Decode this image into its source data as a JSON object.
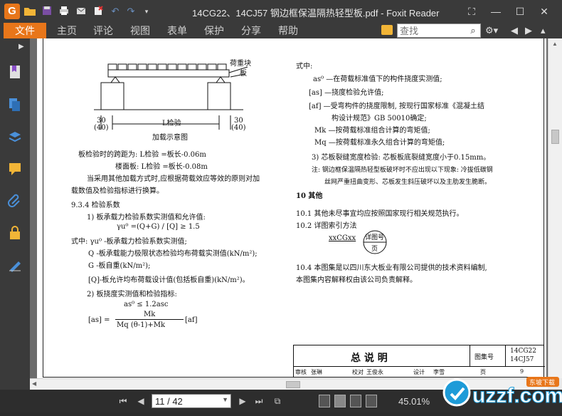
{
  "window": {
    "title": "14CG22、14CJ57 钢边框保温隔热轻型板.pdf - Foxit Reader",
    "app_logo": "G"
  },
  "quick_access": [
    "open-folder-icon",
    "save-icon",
    "print-icon",
    "email-icon",
    "delete-icon",
    "undo-icon",
    "redo-icon",
    "customize-icon"
  ],
  "menu": {
    "file": "文件",
    "items": [
      "主页",
      "评论",
      "视图",
      "表单",
      "保护",
      "分享",
      "帮助"
    ],
    "search_placeholder": "查找"
  },
  "sidebar_icons": [
    "bookmark-icon",
    "pages-icon",
    "layers-icon",
    "comments-icon",
    "attachments-icon",
    "security-icon",
    "signature-icon"
  ],
  "document": {
    "left": {
      "diagram_label_top": "荷重块",
      "diagram_label_plate": "板",
      "dim_left": "30",
      "dim_left_paren": "(40)",
      "dim_right": "30",
      "dim_right_paren": "(40)",
      "span_label": "L检验",
      "caption": "加载示意图",
      "span1": "板检验时的跨距为: L检验 =板长-0.06m",
      "span2": "楼面板: L检验 =板长-0.08m",
      "para1": "当采用其他加载方式时,应根据荷载效应等效的原则对加",
      "para2": "载数值及检验指标进行换算。",
      "sec934": "9.3.4 检验系数",
      "item1": "1) 板承载力检验系数实测值和允许值:",
      "formula1": "γu⁰ =(Q+G) / [Q] ≥ 1.5",
      "where1": "式中: γu⁰ -板承载力检验系数实测值;",
      "where2": "Q -板承载能力极限状态检验均布荷载实测值(kN/m²);",
      "where3": "G -板自重(kN/m²);",
      "where4": "[Q]-板允许均布荷载设计值(包括板自重)(kN/m²)。",
      "item2": "2) 板挠度实测值和检验指标:",
      "formula2": "as⁰ ≤ 1.2asc",
      "formula3_left": "[as] =",
      "formula3_num": "Mk",
      "formula3_den": "Mq (θ-1)+Mk",
      "formula3_right": "[af]"
    },
    "right": {
      "where_head": "式中:",
      "r1": "as⁰ —在荷载标准值下的构件挠度实测值;",
      "r2": "[as] —挠度检验允许值;",
      "r3": "[af] —受弯构件的挠度限制, 按现行国家标准《混凝土结",
      "r4": "构设计规范》GB 50010确定;",
      "r5": "Mk —按荷载标准组合计算的弯矩值;",
      "r6": "Mq —按荷载标准永久组合计算的弯矩值;",
      "r7": "3) 芯板裂缝宽度检验: 芯板板底裂缝宽度小于0.15mm。",
      "note1": "注: 钢边框保温隔热轻型板破坏时不应出现以下现象: 冷拔低碳钢",
      "note2": "丝网严重扭曲变形、芯板发生斜压破坏以及主肋发生脆断。",
      "sec10": "10  其他",
      "s101": "10.1 其他未尽事宜均应按照国家现行相关规范执行。",
      "s102": "10.2 详图索引方法",
      "xxcg": "xxCGxx",
      "detail_top": "详图号",
      "detail_bottom": "页",
      "s104a": "10.4 本图集是以四川东大板业有限公司提供的技术资料编制,",
      "s104b": "本图集内容解释权由该公司负责解释。"
    },
    "titleblock": {
      "title": "总  说  明",
      "atlas_label": "图集号",
      "atlas1": "14CG22",
      "atlas2": "14CJ57",
      "row": [
        "审核",
        "张琳",
        "校对",
        "王俊永",
        "设计",
        "李雪",
        "页",
        "9"
      ]
    }
  },
  "status": {
    "page": "11 / 42",
    "zoom": "45.01%"
  },
  "watermark": {
    "text": "uzzf.com",
    "sub": "东坡下载"
  }
}
